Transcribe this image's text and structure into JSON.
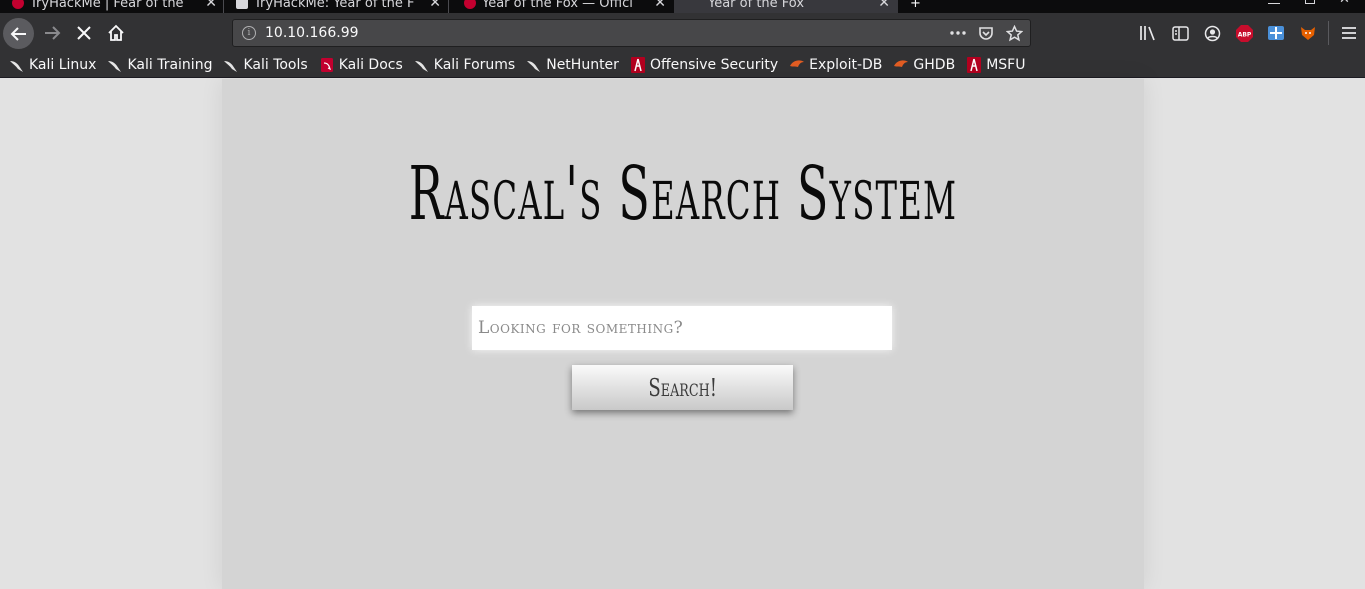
{
  "browser": {
    "tabs": [
      {
        "title": "TryHackMe | Fear of the ",
        "icon_color": "#c3002f",
        "active": false
      },
      {
        "title": "TryHackMe: Year of the F",
        "icon_color": "#d7d7db",
        "active": false
      },
      {
        "title": "Year of the Fox — Offici",
        "icon_color": "#c3002f",
        "active": false
      },
      {
        "title": "Year of the Fox",
        "icon_color": "",
        "active": true
      }
    ],
    "new_tab_label": "+",
    "address": "10.10.166.99",
    "bookmarks": [
      {
        "label": "Kali Linux",
        "icon": "kali-dragon-icon"
      },
      {
        "label": "Kali Training",
        "icon": "kali-dragon-icon"
      },
      {
        "label": "Kali Tools",
        "icon": "kali-dragon-icon"
      },
      {
        "label": "Kali Docs",
        "icon": "kali-docs-icon"
      },
      {
        "label": "Kali Forums",
        "icon": "kali-dragon-icon"
      },
      {
        "label": "NetHunter",
        "icon": "kali-dragon-icon"
      },
      {
        "label": "Offensive Security",
        "icon": "offsec-icon"
      },
      {
        "label": "Exploit-DB",
        "icon": "exploitdb-icon"
      },
      {
        "label": "GHDB",
        "icon": "exploitdb-icon"
      },
      {
        "label": "MSFU",
        "icon": "offsec-icon"
      }
    ],
    "colors": {
      "chrome": "#323234",
      "tabstrip": "#0c0c0d",
      "accent_red": "#c3002f",
      "exploit_orange": "#e25d23"
    }
  },
  "site": {
    "title": "Rascal's Search System",
    "search_placeholder": "Looking for something?",
    "search_button": "Search!"
  }
}
